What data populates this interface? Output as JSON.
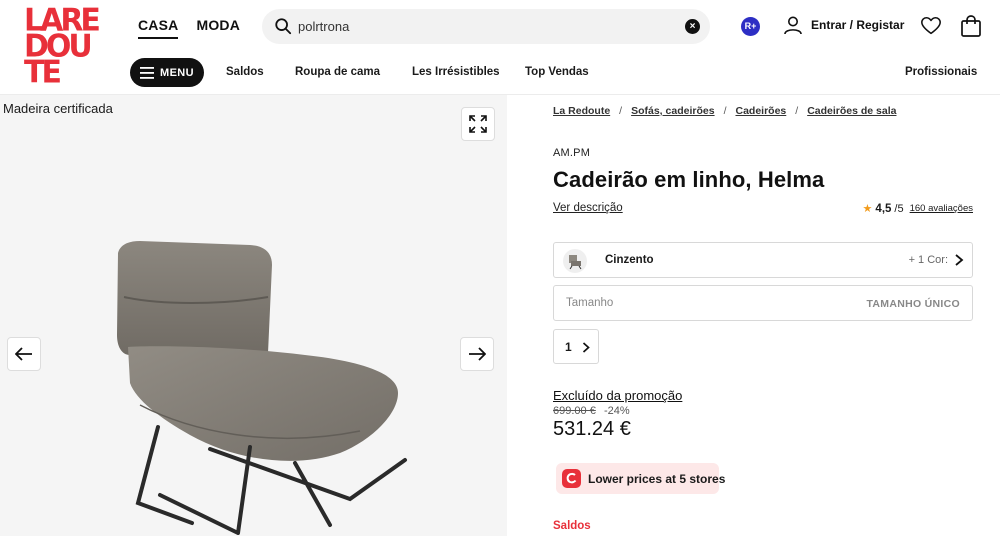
{
  "header": {
    "logo_lines": [
      "LARE",
      "DOU",
      "TE"
    ],
    "categories": [
      {
        "label": "CASA",
        "active": true
      },
      {
        "label": "MODA",
        "active": false
      }
    ],
    "search": {
      "value": "polrtrona"
    },
    "rplus_label": "R+",
    "account_label": "Entrar / Registar",
    "menu_label": "MENU",
    "subnav": [
      "Saldos",
      "Roupa de cama",
      "Les Irrésistibles",
      "Top Vendas"
    ],
    "pro_link": "Profissionais"
  },
  "gallery": {
    "badge": "Madeira certificada"
  },
  "product": {
    "breadcrumb": [
      "La Redoute",
      "Sofás, cadeirões",
      "Cadeirões",
      "Cadeirões de sala"
    ],
    "brand": "AM.PM",
    "title": "Cadeirão em linho, Helma",
    "description_link": "Ver descrição",
    "rating": {
      "value": "4,5",
      "max": "/5",
      "reviews": "160 avaliações"
    },
    "color": {
      "name": "Cinzento",
      "more": "+ 1 Cor:"
    },
    "size": {
      "label": "Tamanho",
      "value": "TAMANHO ÚNICO"
    },
    "quantity": "1",
    "promo_excluded": "Excluído da promoção",
    "old_price": "699.00 €",
    "discount": "-24%",
    "price": "531.24 €",
    "stores_label": "Lower prices at 5 stores",
    "sale_tag": "Saldos"
  },
  "colors": {
    "brand_red": "#e8303a",
    "rplus_blue": "#2d2ec4",
    "star": "#f29b1b"
  }
}
